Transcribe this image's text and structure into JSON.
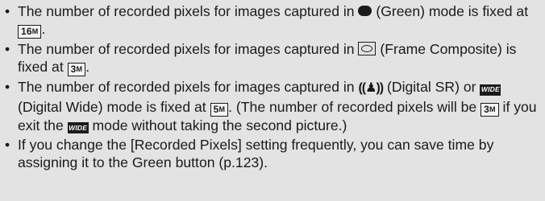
{
  "bullet_glyph": "•",
  "icons": {
    "green": "green-mode-icon",
    "frame": "frame-composite-icon",
    "digital_sr": "digital-sr-icon",
    "digital_wide": "digital-wide-icon",
    "size_16m": "16M",
    "size_3m": "3M",
    "size_5m": "5M"
  },
  "notes": {
    "n1": {
      "a": "The number of recorded pixels for images captured in ",
      "b": " (Green) mode is fixed at ",
      "c": "."
    },
    "n2": {
      "a": "The number of recorded pixels for images captured in ",
      "b": " (Frame Composite) is fixed at ",
      "c": "."
    },
    "n3": {
      "a": "The number of recorded pixels for images captured in ",
      "sr_icon": "((♟))",
      "b": " (Digital SR) or ",
      "wide_icon": "WIDE",
      "c": " (Digital Wide) mode is fixed at ",
      "d": ". (The number of recorded pixels will be ",
      "e": " if you exit the ",
      "wide_icon2": "WIDE",
      "f": " mode without taking the second picture.)"
    },
    "n4": {
      "text": "If you change the [Recorded Pixels] setting frequently, you can save time by assigning it to the Green button (p.123)."
    }
  },
  "badges": {
    "m16": {
      "num": "16",
      "unit": "M"
    },
    "m3": {
      "num": "3",
      "unit": "M"
    },
    "m5": {
      "num": "5",
      "unit": "M"
    }
  }
}
